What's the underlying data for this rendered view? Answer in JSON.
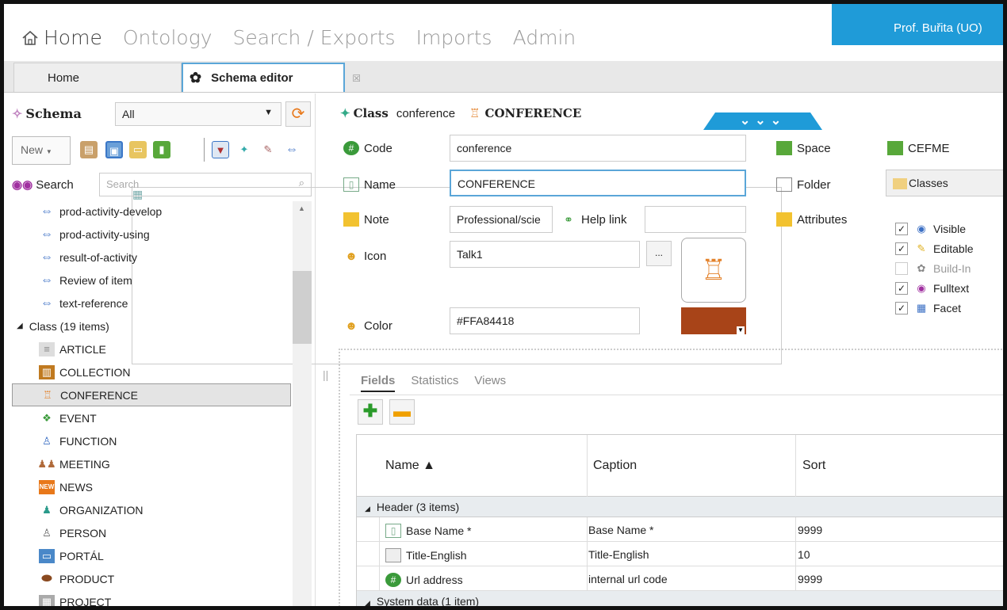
{
  "menu": {
    "home": "Home",
    "ontology": "Ontology",
    "search_exports": "Search / Exports",
    "imports": "Imports",
    "admin": "Admin"
  },
  "user": "Prof. Buřita (UO)",
  "tabs": {
    "home": "Home",
    "schema_editor": "Schema editor",
    "close": "☒"
  },
  "left": {
    "schema_title": "Schema",
    "filter_value": "All",
    "new_label": "New",
    "search_label": "Search",
    "search_placeholder": "Search",
    "relations": [
      "prod-activity-develop",
      "prod-activity-using",
      "result-of-activity",
      "Review of item",
      "text-reference"
    ],
    "class_group": "Class (19 items)",
    "classes": [
      "ARTICLE",
      "COLLECTION",
      "CONFERENCE",
      "EVENT",
      "FUNCTION",
      "MEETING",
      "NEWS",
      "ORGANIZATION",
      "PERSON",
      "PORTÁL",
      "PRODUCT",
      "PROJECT"
    ],
    "selected_class": "CONFERENCE"
  },
  "class": {
    "type_label": "Class",
    "code": "conference",
    "name": "CONFERENCE",
    "fields": {
      "code_label": "Code",
      "code_value": "conference",
      "name_label": "Name",
      "name_value": "CONFERENCE",
      "note_label": "Note",
      "note_value": "Professional/scie",
      "helplink_label": "Help link",
      "helplink_value": "",
      "icon_label": "Icon",
      "icon_value": "Talk1",
      "icon_button": "...",
      "color_label": "Color",
      "color_value": "#FFA84418",
      "space_label": "Space",
      "space_value": "CEFME",
      "folder_label": "Folder",
      "folder_value": "Classes",
      "attributes_label": "Attributes"
    },
    "attributes": [
      {
        "label": "Visible",
        "checked": true,
        "disabled": false
      },
      {
        "label": "Editable",
        "checked": true,
        "disabled": false
      },
      {
        "label": "Build-In",
        "checked": false,
        "disabled": true
      },
      {
        "label": "Fulltext",
        "checked": true,
        "disabled": false
      },
      {
        "label": "Facet",
        "checked": true,
        "disabled": false
      }
    ],
    "swatch_color": "#A84418"
  },
  "fields_panel": {
    "tabs": [
      "Fields",
      "Statistics",
      "Views"
    ],
    "columns": [
      "Name ▲",
      "Caption",
      "Sort"
    ],
    "groups": [
      {
        "title": "Header (3 items)",
        "rows": [
          {
            "name": "Base Name *",
            "caption": "Base Name *",
            "sort": "9999",
            "icon": "book-icon"
          },
          {
            "name": "Title-English",
            "caption": "Title-English",
            "sort": "10",
            "icon": "textbox-icon"
          },
          {
            "name": "Url address",
            "caption": "internal url code",
            "sort": "9999",
            "icon": "hash-icon"
          }
        ]
      },
      {
        "title": "System data (1 item)",
        "rows": []
      }
    ]
  }
}
